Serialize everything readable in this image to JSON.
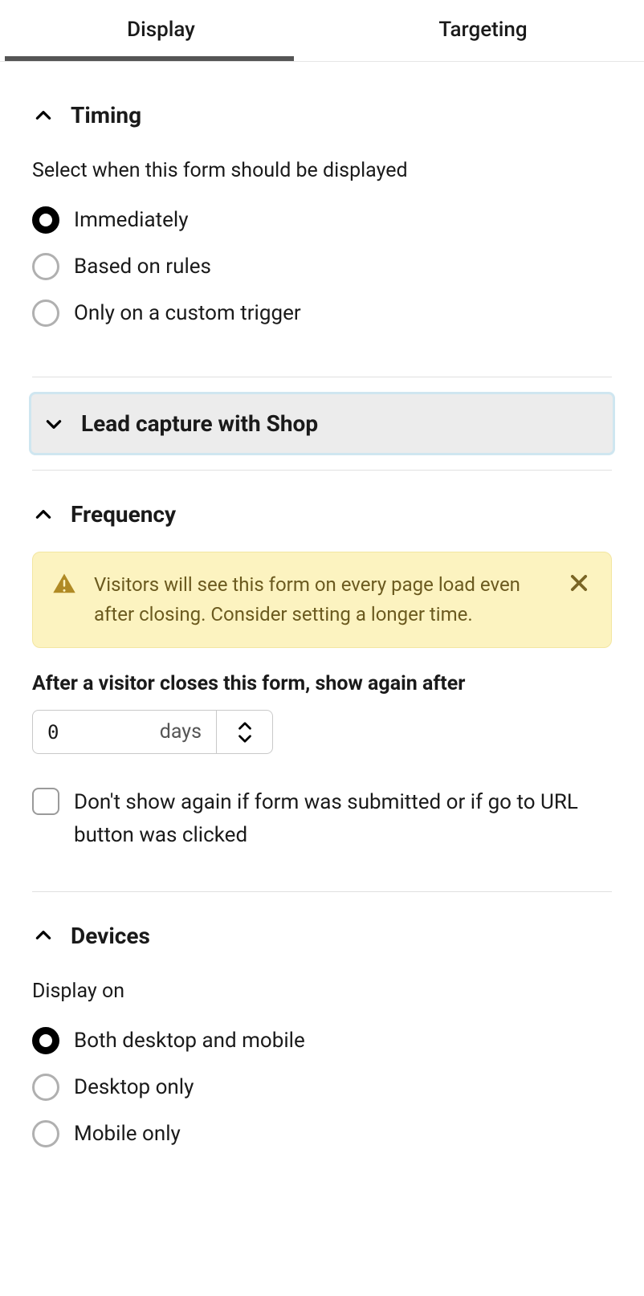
{
  "tabs": {
    "display": "Display",
    "targeting": "Targeting"
  },
  "timing": {
    "title": "Timing",
    "subtitle": "Select when this form should be displayed",
    "options": {
      "immediately": "Immediately",
      "rules": "Based on rules",
      "custom": "Only on a custom trigger"
    }
  },
  "lead": {
    "title": "Lead capture with Shop"
  },
  "frequency": {
    "title": "Frequency",
    "warning": "Visitors will see this form on every page load even after closing. Consider setting a longer time.",
    "after_label": "After a visitor closes this form, show again after",
    "value": "0",
    "unit": "days",
    "checkbox_label": "Don't show again if form was submitted or if go to URL button was clicked"
  },
  "devices": {
    "title": "Devices",
    "subtitle": "Display on",
    "options": {
      "both": "Both desktop and mobile",
      "desktop": "Desktop only",
      "mobile": "Mobile only"
    }
  }
}
